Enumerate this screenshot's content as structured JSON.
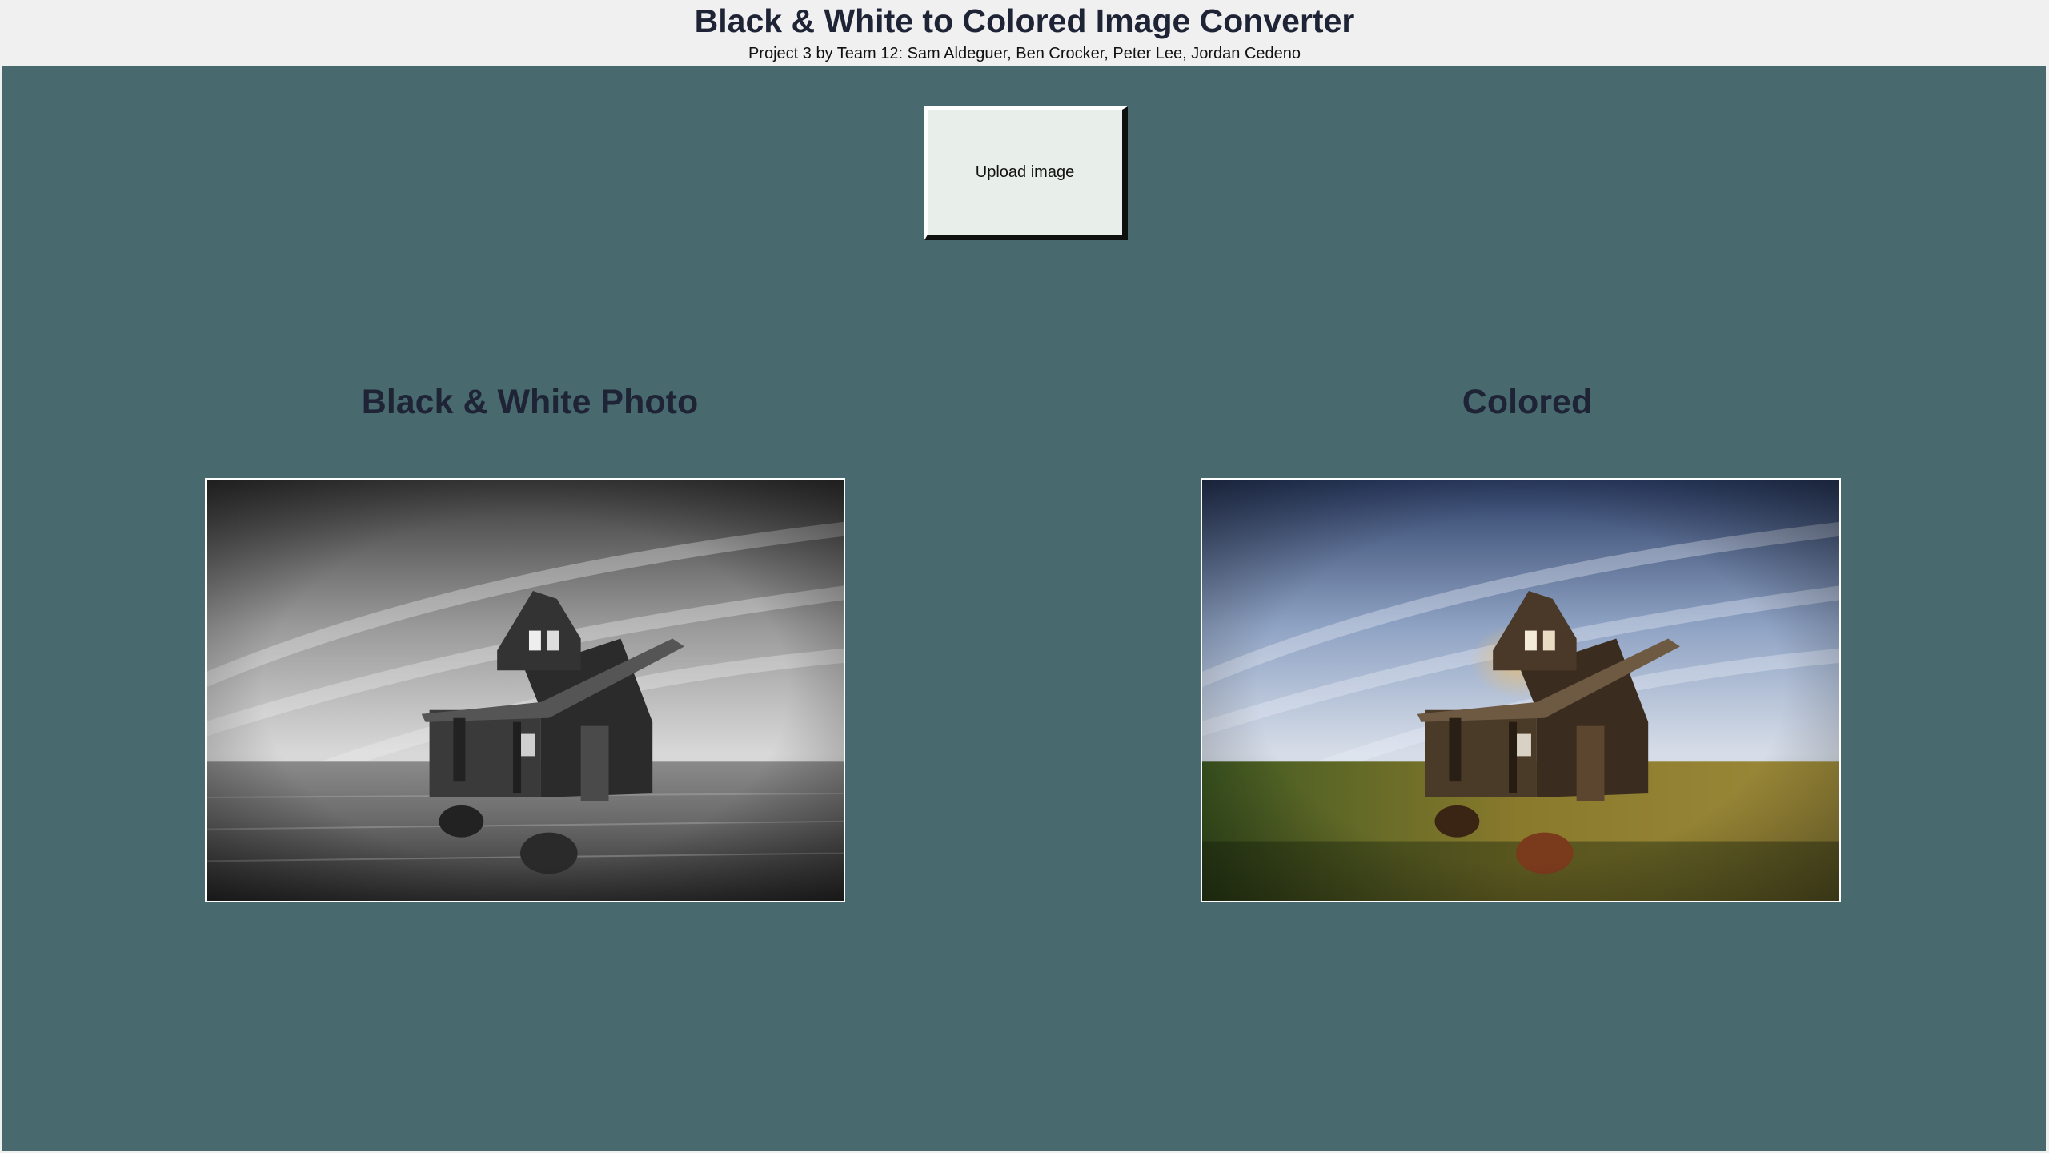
{
  "header": {
    "title": "Black & White to Colored Image Converter",
    "subtitle": "Project 3 by Team 12: Sam Aldeguer, Ben Crocker, Peter Lee, Jordan Cedeno"
  },
  "upload": {
    "label": "Upload image"
  },
  "panels": {
    "bw": {
      "title": "Black & White Photo"
    },
    "colored": {
      "title": "Colored"
    }
  },
  "colors": {
    "background": "#486a6f",
    "header_bg": "#f0f0f0",
    "heading_text": "#1e2436",
    "button_bg": "#e8efea"
  }
}
